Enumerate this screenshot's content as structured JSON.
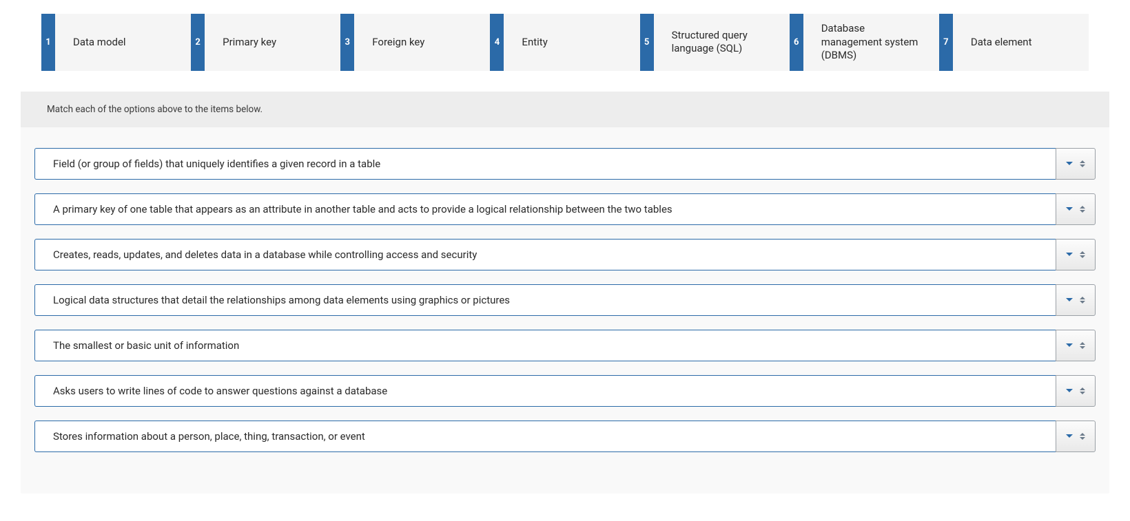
{
  "options": [
    {
      "num": "1",
      "label": "Data model"
    },
    {
      "num": "2",
      "label": "Primary key"
    },
    {
      "num": "3",
      "label": "Foreign key"
    },
    {
      "num": "4",
      "label": "Entity"
    },
    {
      "num": "5",
      "label": "Structured query language (SQL)"
    },
    {
      "num": "6",
      "label": "Database management system (DBMS)"
    },
    {
      "num": "7",
      "label": "Data element"
    }
  ],
  "instruction": "Match each of the options above to the items below.",
  "items": [
    "Field (or group of fields) that uniquely identifies a given record in a table",
    "A primary key of one table that appears as an attribute in another table and acts to provide a logical relationship between the two tables",
    "Creates, reads, updates, and deletes data in a database while controlling access and security",
    "Logical data structures that detail the relationships among data elements using graphics or pictures",
    "The smallest or basic unit of information",
    "Asks users to write lines of code to answer questions against a database",
    "Stores information about a person, place, thing, transaction, or event"
  ]
}
